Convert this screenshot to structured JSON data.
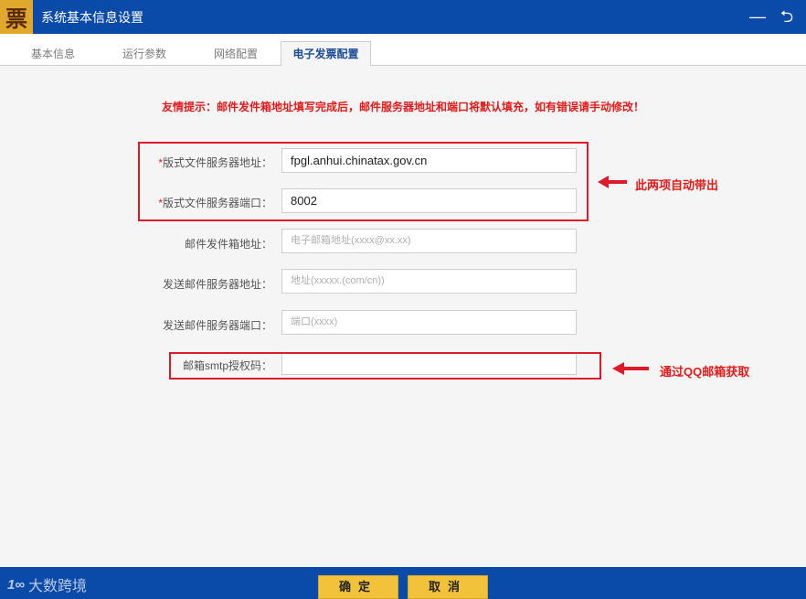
{
  "window": {
    "logo_text": "票",
    "title": "系统基本信息设置",
    "minimize_glyph": "—",
    "back_glyph": "⮌"
  },
  "tabs": [
    {
      "label": "基本信息"
    },
    {
      "label": "运行参数"
    },
    {
      "label": "网络配置"
    },
    {
      "label": "电子发票配置",
      "active": true
    }
  ],
  "hint": "友情提示：邮件发件箱地址填写完成后，邮件服务器地址和端口将默认填充，如有错误请手动修改！",
  "form": {
    "required_mark": "*",
    "server_address": {
      "label": "版式文件服务器地址：",
      "value": "fpgl.anhui.chinatax.gov.cn"
    },
    "server_port": {
      "label": "版式文件服务器端口：",
      "value": "8002"
    },
    "sender_email": {
      "label": "邮件发件箱地址：",
      "placeholder": "电子邮箱地址(xxxx@xx.xx)"
    },
    "smtp_address": {
      "label": "发送邮件服务器地址：",
      "placeholder": "地址(xxxxx.(com/cn))"
    },
    "smtp_port": {
      "label": "发送邮件服务器端口：",
      "placeholder": "端口(xxxx)"
    },
    "smtp_auth_code": {
      "label": "邮箱smtp授权码：",
      "value": ""
    }
  },
  "annotations": {
    "auto_fill": "此两项自动带出",
    "qq_mail": "通过QQ邮箱获取",
    "color": "#e01a2a"
  },
  "footer": {
    "confirm": "确定",
    "cancel": "取消",
    "watermark": "大数跨境",
    "watermark_mark": "1∞"
  },
  "colors": {
    "titlebar": "#0a4aa8",
    "button": "#f2c23a",
    "active_tab_text": "#1c4d96"
  }
}
